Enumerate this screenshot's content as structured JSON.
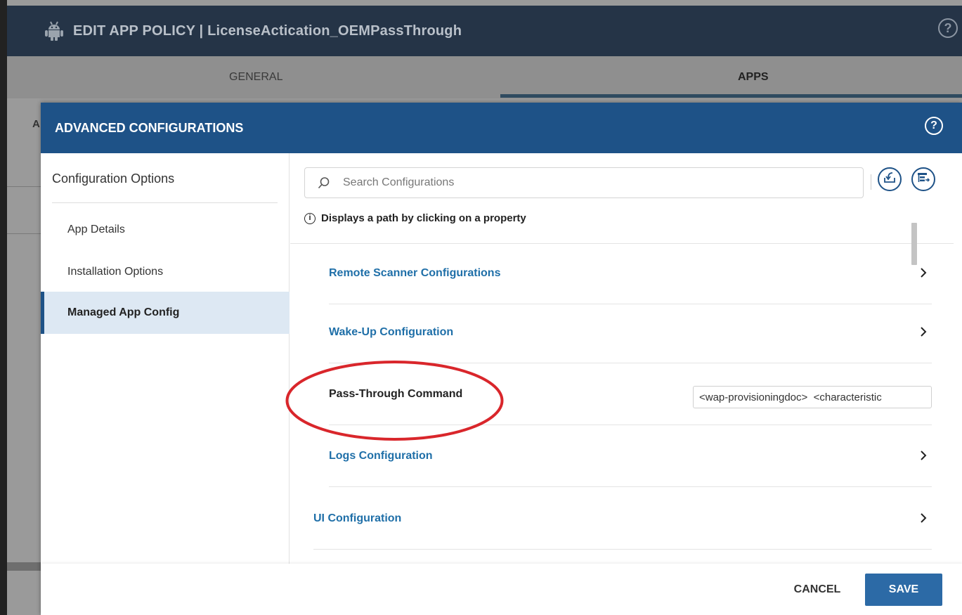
{
  "app_header": {
    "title": "EDIT APP POLICY  |  LicenseActication_OEMPassThrough",
    "help_symbol": "?"
  },
  "policy_tabs": [
    {
      "label": "GENERAL",
      "active": false
    },
    {
      "label": "APPS",
      "active": true
    }
  ],
  "background_partial_text": "A",
  "modal": {
    "title": "ADVANCED CONFIGURATIONS",
    "help_symbol": "?"
  },
  "sidebar": {
    "heading": "Configuration Options",
    "items": [
      {
        "label": "App Details",
        "active": false
      },
      {
        "label": "Installation Options",
        "active": false
      },
      {
        "label": "Managed App Config",
        "active": true
      }
    ]
  },
  "search": {
    "placeholder": "Search Configurations",
    "value": ""
  },
  "info": {
    "icon_symbol": "i",
    "text": "Displays a path by clicking on a property"
  },
  "config_rows": [
    {
      "label": "Remote Scanner Configurations",
      "type": "expandable"
    },
    {
      "label": "Wake-Up Configuration",
      "type": "expandable"
    },
    {
      "label": "Pass-Through Command",
      "type": "text",
      "value": "<wap-provisioningdoc>  <characteristic",
      "highlighted": true
    },
    {
      "label": "Logs Configuration",
      "type": "expandable"
    },
    {
      "label": "UI Configuration",
      "type": "expandable"
    }
  ],
  "footer": {
    "cancel_label": "CANCEL",
    "save_label": "SAVE"
  },
  "colors": {
    "modal_header": "#1e5287",
    "link_blue": "#1f6fa8",
    "save_button": "#2c6aa6",
    "highlight_ellipse": "#d9262b",
    "active_sidebar_bg": "#dde8f3"
  },
  "icons": [
    "android-icon",
    "help-icon",
    "search-icon",
    "import-icon",
    "expand-icon",
    "info-icon",
    "chevron-right-icon"
  ]
}
